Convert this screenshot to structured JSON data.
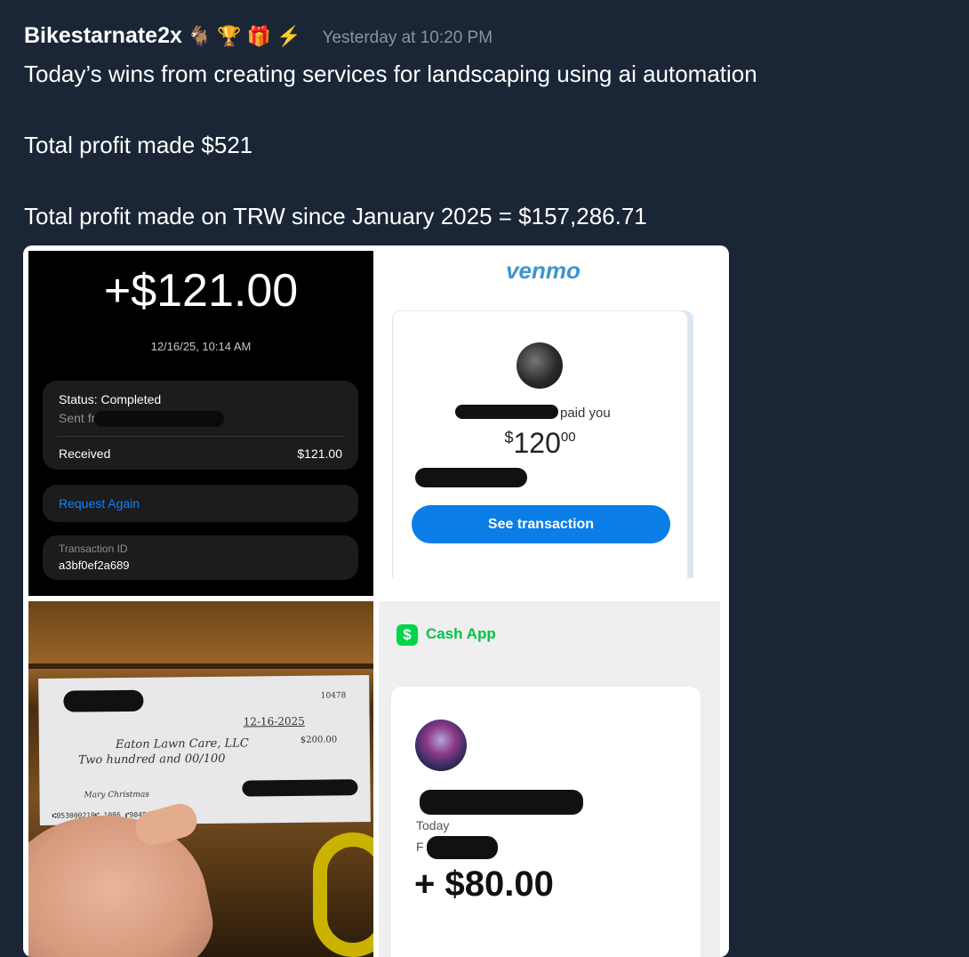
{
  "message": {
    "username": "Bikestarnate2x",
    "badges": [
      "🐐",
      "🏆",
      "🎁",
      "⚡"
    ],
    "timestamp": "Yesterday at 10:20 PM",
    "lines": [
      "Today’s wins from creating services for landscaping using ai automation",
      "Total profit made $521",
      "Total profit made on TRW since January 2025 = $157,286.71"
    ]
  },
  "apple_cash": {
    "amount": "+$121.00",
    "date": "12/16/25, 10:14 AM",
    "status": "Status: Completed",
    "sent_from": "Sent fro",
    "received_label": "Received",
    "received_value": "$121.00",
    "request_again": "Request Again",
    "transaction_id_label": "Transaction ID",
    "transaction_id": "a3bf0ef2a689"
  },
  "venmo": {
    "logo": "venmo",
    "paid_text": "paid you",
    "currency": "$",
    "amount_int": "120",
    "amount_cents": "00",
    "button": "See transaction"
  },
  "check": {
    "number": "10478",
    "date": "12-16-2025",
    "payee": "Eaton Lawn Care, LLC",
    "amount": "$200.00",
    "amount_words": "Two hundred and 00/100",
    "memo": "Mary Christmas",
    "micr": "⑆053000219⑆ 1086 ⑈90488 ⑈10478"
  },
  "cash_app": {
    "logo_symbol": "$",
    "name": "Cash App",
    "today": "Today",
    "from_prefix": "F",
    "amount": "+ $80.00"
  },
  "colors": {
    "background": "#1a2636",
    "venmo_blue": "#3d95ce",
    "venmo_button": "#0a7ee6",
    "cashapp_green": "#00d54b",
    "apple_link": "#0a84ff"
  }
}
